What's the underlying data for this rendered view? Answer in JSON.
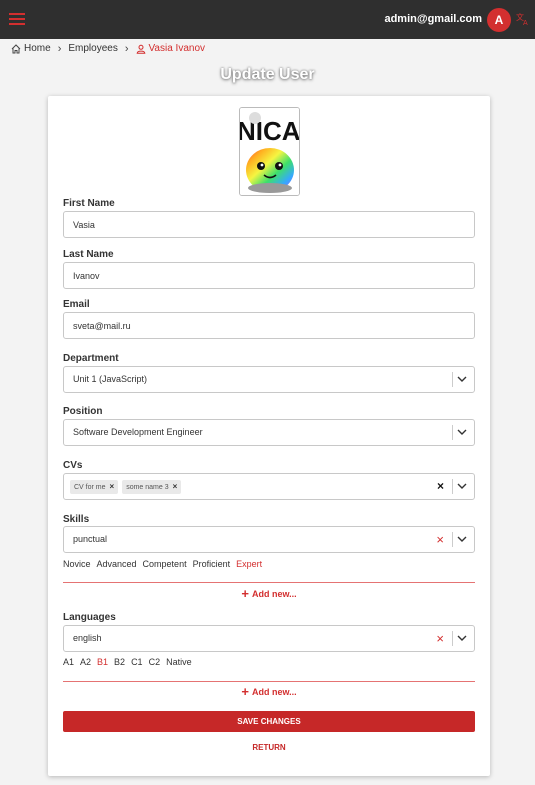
{
  "header": {
    "user_email": "admin@gmail.com",
    "avatar_letter": "A",
    "menu_icon": "hamburger-menu-icon",
    "translate_icon": "translate-icon",
    "accent_color": "#d32f2f",
    "bar_color": "#2f2f2f"
  },
  "breadcrumb": {
    "home": "Home",
    "employees": "Employees",
    "current": "Vasia Ivanov"
  },
  "page": {
    "title": "Update User"
  },
  "avatar_image": {
    "text": "NICA"
  },
  "form": {
    "first_name": {
      "label": "First Name",
      "value": "Vasia"
    },
    "last_name": {
      "label": "Last Name",
      "value": "Ivanov"
    },
    "email": {
      "label": "Email",
      "value": "sveta@mail.ru"
    },
    "department": {
      "label": "Department",
      "value": "Unit 1 (JavaScript)"
    },
    "position": {
      "label": "Position",
      "value": "Software Development Engineer"
    },
    "cvs": {
      "label": "CVs",
      "chips": [
        "CV for me",
        "some name 3"
      ]
    },
    "skills": {
      "label": "Skills",
      "value": "punctual",
      "levels": [
        "Novice",
        "Advanced",
        "Competent",
        "Proficient",
        "Expert"
      ],
      "selected_level": "Expert",
      "add_new": "Add new..."
    },
    "languages": {
      "label": "Languages",
      "value": "english",
      "levels": [
        "A1",
        "A2",
        "B1",
        "B2",
        "C1",
        "C2",
        "Native"
      ],
      "selected_level": "B1",
      "add_new": "Add new..."
    }
  },
  "actions": {
    "save": "SAVE CHANGES",
    "return": "RETURN"
  }
}
